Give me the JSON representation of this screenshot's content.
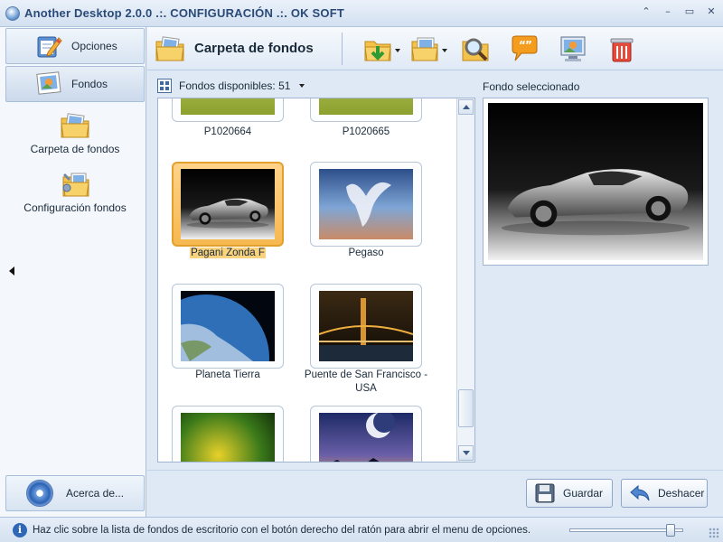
{
  "window": {
    "title": "Another Desktop 2.0.0  .:.  CONFIGURACIÓN  .:.  OK SOFT",
    "controls": [
      "⌃",
      "–",
      "▭",
      "✕"
    ]
  },
  "sidebar": {
    "nav": [
      {
        "label": "Opciones",
        "icon": "notepad-pencil-icon"
      },
      {
        "label": "Fondos",
        "icon": "picture-icon"
      }
    ],
    "tasks": [
      {
        "label": "Carpeta de fondos",
        "icon": "image-folder-icon"
      },
      {
        "label": "Configuración fondos",
        "icon": "folder-settings-icon"
      }
    ],
    "about_label": "Acerca de..."
  },
  "toolbar": {
    "title": "Carpeta de fondos",
    "buttons": [
      "add-to-folder-icon",
      "folder-options-icon",
      "search-icon",
      "comment-icon",
      "set-wallpaper-icon",
      "delete-icon"
    ]
  },
  "gallery": {
    "count_label": "Fondos disponibles: 51",
    "items": [
      {
        "label": "P1020664",
        "selected": false
      },
      {
        "label": "P1020665",
        "selected": false
      },
      {
        "label": "Pagani Zonda F",
        "selected": true
      },
      {
        "label": "Pegaso",
        "selected": false
      },
      {
        "label": "Planeta Tierra",
        "selected": false
      },
      {
        "label": "Puente de San Francisco - USA",
        "selected": false
      },
      {
        "label": "",
        "selected": false
      },
      {
        "label": "",
        "selected": false
      }
    ]
  },
  "preview": {
    "label": "Fondo seleccionado"
  },
  "actions": {
    "save_label": "Guardar",
    "undo_label": "Deshacer"
  },
  "status": {
    "text": "Haz clic sobre la lista de fondos de escritorio con el botón derecho del ratón para abrir el menu de opciones.",
    "slider_value": 0.92
  },
  "colors": {
    "accent": "#f6b84f",
    "selection_border": "#e2a12c",
    "panel_bg": "#dfe9f5"
  }
}
